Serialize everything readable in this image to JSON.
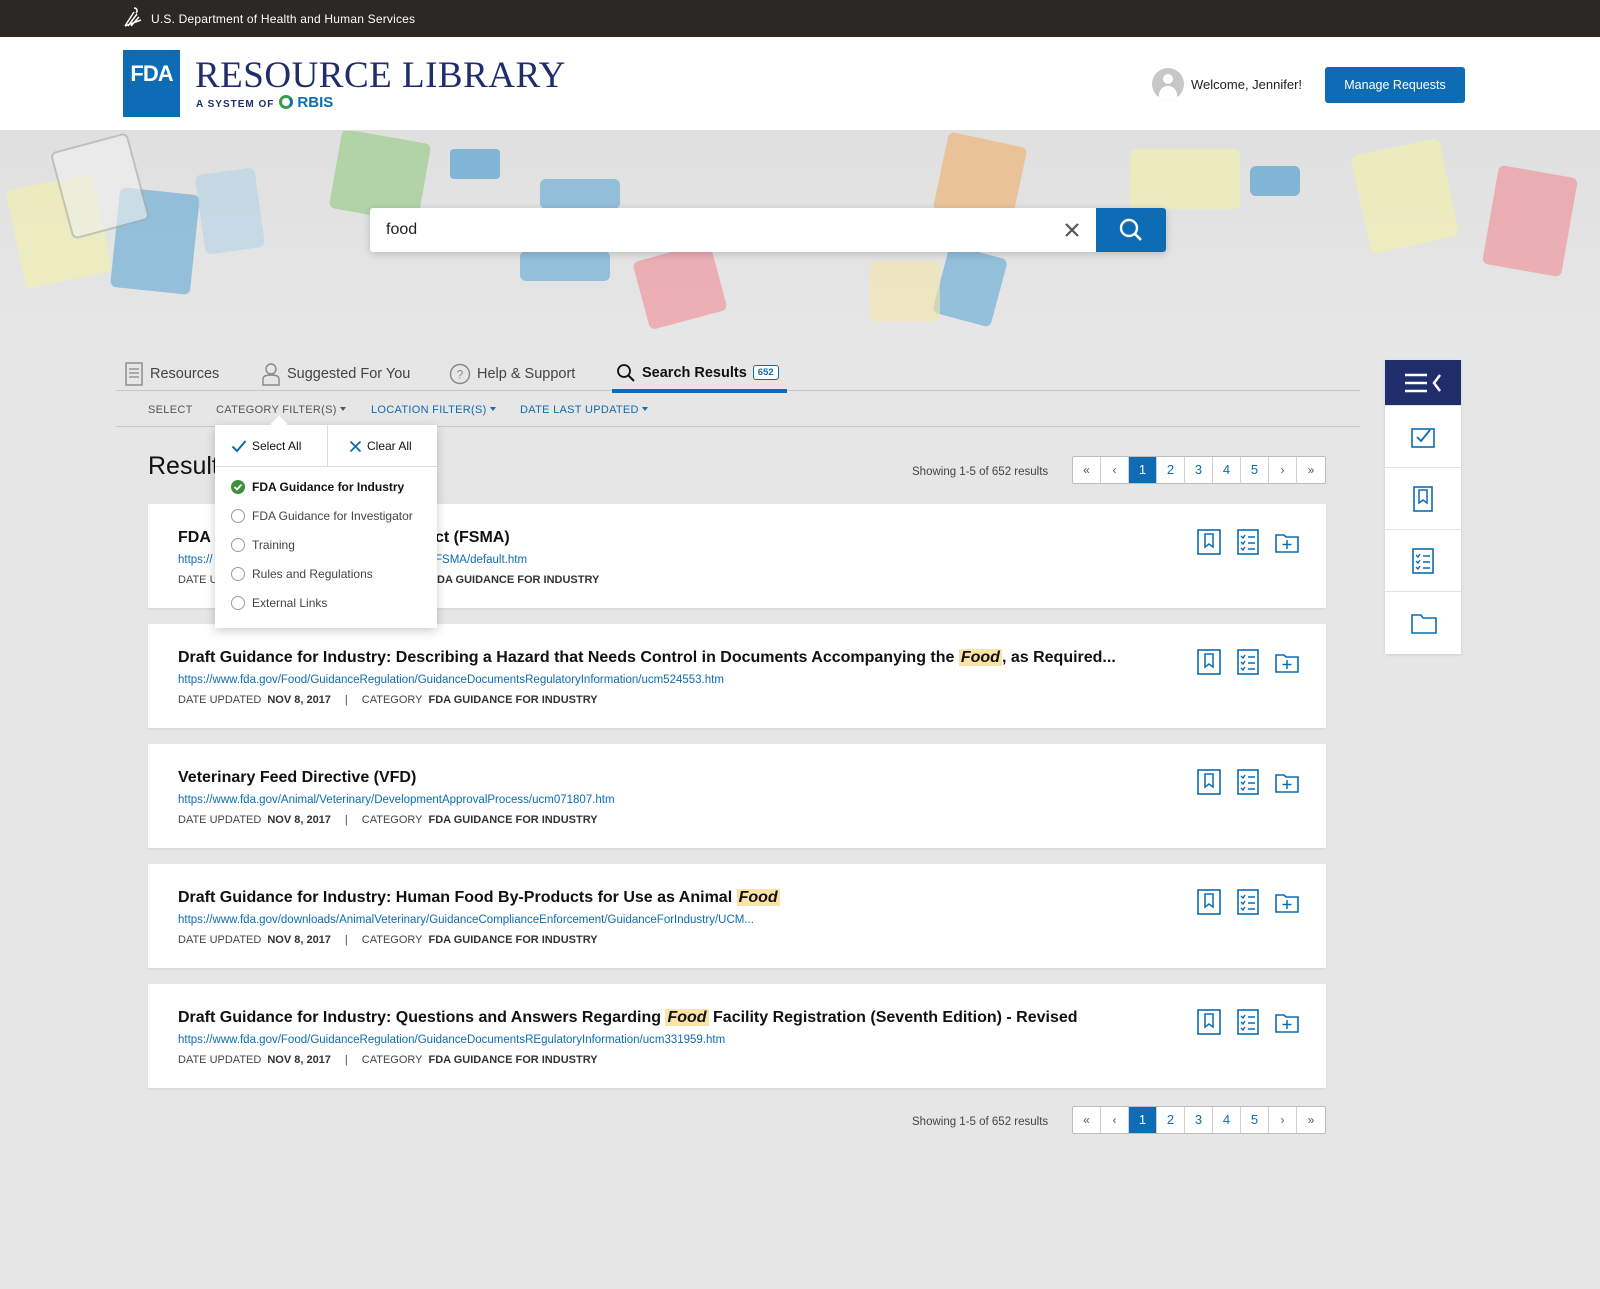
{
  "gov_bar": {
    "text": "U.S. Department of Health and Human Services"
  },
  "header": {
    "logo_text": "FDA",
    "title": "RESOURCE LIBRARY",
    "subtitle_prefix": "A SYSTEM OF",
    "subtitle_brand": "RBIS",
    "welcome": "Welcome, Jennifer!",
    "manage_button": "Manage Requests"
  },
  "search": {
    "value": "food",
    "placeholder": ""
  },
  "tabs": [
    {
      "label": "Resources",
      "icon": "document-icon"
    },
    {
      "label": "Suggested For You",
      "icon": "user-icon"
    },
    {
      "label": "Help & Support",
      "icon": "help-icon"
    },
    {
      "label": "Search Results",
      "icon": "search-icon",
      "count": "652",
      "active": true
    }
  ],
  "filters": {
    "select": "SELECT",
    "category": "CATEGORY FILTER(S)",
    "location": "LOCATION FILTER(S)",
    "date": "DATE LAST UPDATED"
  },
  "results_title": "Results",
  "pagination": {
    "showing": "Showing 1-5 of 652 results",
    "first": "«",
    "prev": "‹",
    "next": "›",
    "last": "»",
    "pages": [
      "1",
      "2",
      "3",
      "4",
      "5"
    ],
    "current": "1"
  },
  "dropdown": {
    "select_all": "Select All",
    "clear_all": "Clear All",
    "options": [
      {
        "label": "FDA Guidance for Industry",
        "checked": true
      },
      {
        "label": "FDA Guidance for Investigator",
        "checked": false
      },
      {
        "label": "Training",
        "checked": false
      },
      {
        "label": "Rules and Regulations",
        "checked": false
      },
      {
        "label": "External Links",
        "checked": false
      }
    ]
  },
  "results": [
    {
      "title_a": "FDA",
      "title_b": "ct (FSMA)",
      "url_a": "https://",
      "url_b": "FSMA/default.htm",
      "date_label_a": "DATE U",
      "category_value_b": "DA GUIDANCE FOR INDUSTRY"
    },
    {
      "title_before": "Draft Guidance for Industry: Describing a Hazard that Needs Control in Documents Accompanying the ",
      "title_hl": "Food",
      "title_after": ", as Required...",
      "url": "https://www.fda.gov/Food/GuidanceRegulation/GuidanceDocumentsRegulatoryInformation/ucm524553.htm",
      "date_label": "DATE UPDATED",
      "date": "NOV 8, 2017",
      "sep": "|",
      "category_label": "CATEGORY",
      "category": "FDA GUIDANCE FOR INDUSTRY"
    },
    {
      "title_before": "Veterinary Feed Directive (VFD)",
      "title_hl": "",
      "title_after": "",
      "url": "https://www.fda.gov/Animal/Veterinary/DevelopmentApprovalProcess/ucm071807.htm",
      "date_label": "DATE UPDATED",
      "date": "NOV 8, 2017",
      "sep": "|",
      "category_label": "CATEGORY",
      "category": "FDA GUIDANCE FOR INDUSTRY"
    },
    {
      "title_before": "Draft Guidance for Industry: Human Food By-Products for Use as Animal ",
      "title_hl": "Food",
      "title_after": "",
      "url": "https://www.fda.gov/downloads/AnimalVeterinary/GuidanceComplianceEnforcement/GuidanceForIndustry/UCM...",
      "date_label": "DATE UPDATED",
      "date": "NOV 8, 2017",
      "sep": "|",
      "category_label": "CATEGORY",
      "category": "FDA GUIDANCE FOR INDUSTRY"
    },
    {
      "title_before": "Draft Guidance for Industry: Questions and Answers Regarding ",
      "title_hl": "Food",
      "title_after": " Facility Registration (Seventh Edition) - Revised",
      "url": "https://www.fda.gov/Food/GuidanceRegulation/GuidanceDocumentsREgulatoryInformation/ucm331959.htm",
      "date_label": "DATE UPDATED",
      "date": "NOV 8, 2017",
      "sep": "|",
      "category_label": "CATEGORY",
      "category": "FDA GUIDANCE FOR INDUSTRY"
    }
  ],
  "colors": {
    "primary": "#0d6cb3",
    "navy": "#1f2d6b",
    "highlight": "#fbe3a6",
    "check": "#3d8f3a"
  }
}
